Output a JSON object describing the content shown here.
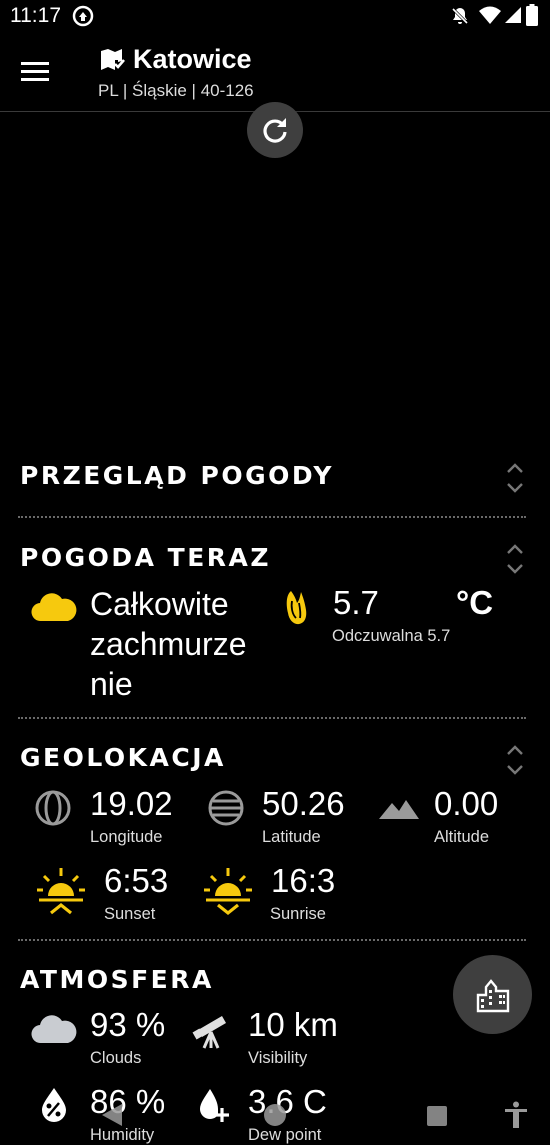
{
  "status_bar": {
    "time": "11:17"
  },
  "header": {
    "city": "Katowice",
    "location_line": "PL | Śląskie | 40-126"
  },
  "sections": {
    "overview": {
      "title": "PRZEGLĄD POGODY"
    },
    "now": {
      "title": "POGODA TERAZ",
      "condition": "Całkowite zachmurzenie",
      "condition_lines": [
        "Całkowite",
        "zachmurze",
        "nie"
      ],
      "temperature": "5.7",
      "unit": "°C",
      "feels_like": "Odczuwalna 5.7"
    },
    "geolocation": {
      "title": "GEOLOKACJA",
      "longitude": {
        "value": "19.02",
        "label": "Longitude"
      },
      "latitude": {
        "value": "50.26",
        "label": "Latitude"
      },
      "altitude": {
        "value": "0.00",
        "label": "Altitude"
      },
      "sunset": {
        "value": "6:53",
        "label": "Sunset"
      },
      "sunrise": {
        "value": "16:3",
        "label": "Sunrise"
      }
    },
    "atmosphere": {
      "title": "ATMOSFERA",
      "clouds": {
        "value": "93 %",
        "label": "Clouds"
      },
      "visibility": {
        "value": "10 km",
        "label": "Visibility"
      },
      "humidity": {
        "value": "86 %",
        "label": "Humidity"
      },
      "dew_point": {
        "value": "3.6 C",
        "label": "Dew point"
      }
    }
  },
  "colors": {
    "accent_yellow": "#F6C90E",
    "cloud_gray": "#C9CCD1",
    "icon_gray": "#9A9A9A",
    "background": "#000000"
  }
}
